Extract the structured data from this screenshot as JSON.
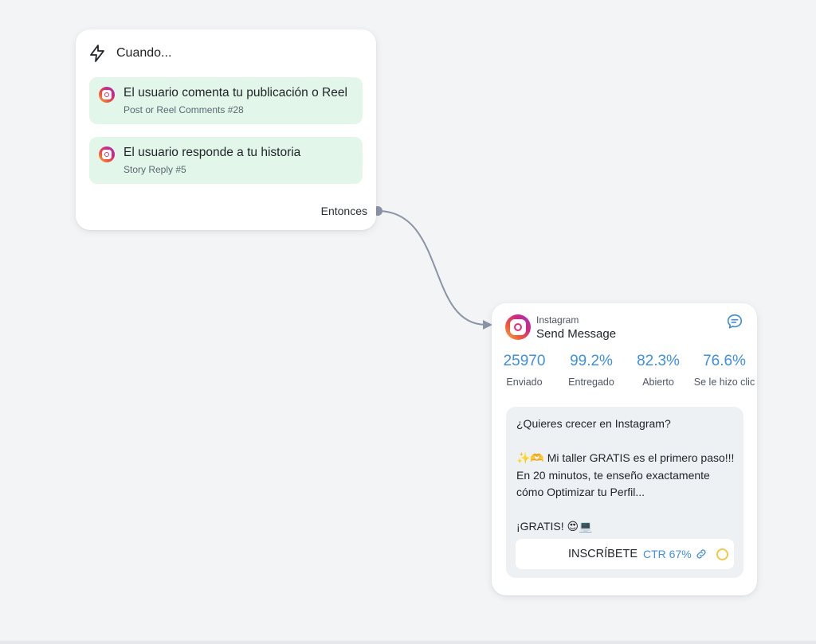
{
  "trigger": {
    "title": "Cuando...",
    "items": [
      {
        "title": "El usuario comenta tu publicación o Reel",
        "subtitle": "Post or Reel Comments #28"
      },
      {
        "title": "El usuario responde a tu historia",
        "subtitle": "Story Reply #5"
      }
    ],
    "then_label": "Entonces"
  },
  "action": {
    "platform": "Instagram",
    "title": "Send Message",
    "stats": [
      {
        "value": "25970",
        "label": "Enviado"
      },
      {
        "value": "99.2%",
        "label": "Entregado"
      },
      {
        "value": "82.3%",
        "label": "Abierto"
      },
      {
        "value": "76.6%",
        "label": "Se le hizo clic"
      }
    ],
    "message": "¿Quieres crecer en Instagram?\n\n✨🫶 Mi taller GRATIS es el primero paso!!!\nEn 20 minutos, te enseño exactamente\ncómo Optimizar tu Perfil...\n\n¡GRATIS! 😍💻",
    "cta": {
      "label": "INSCRÍBETE",
      "ctr": "CTR 67%"
    }
  },
  "colors": {
    "accent_blue": "#3f8fe0",
    "trigger_item_bg": "#e3f6ea",
    "connector": "#8a94a6",
    "status_yellow": "#f2c84b"
  },
  "icons": [
    "lightning-icon",
    "instagram-icon",
    "chat-bubble-icon",
    "link-icon",
    "status-circle-icon"
  ]
}
